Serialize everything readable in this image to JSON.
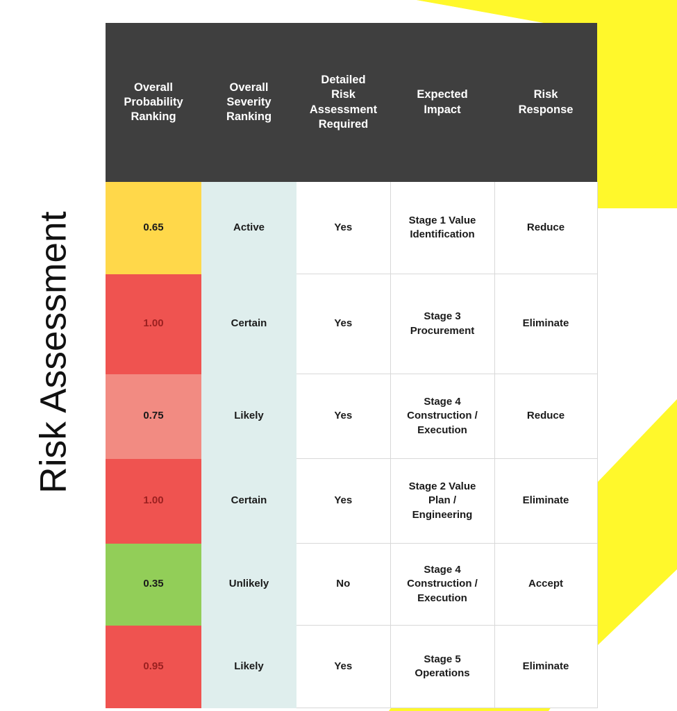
{
  "page": {
    "title": "Risk Assessment",
    "background_color": "#FFFFFF",
    "accent_color": "#FFF82B",
    "header_color": "#3F3F3F"
  },
  "decor": {
    "shapes": [
      {
        "name": "yellow-diagonal-band-top-right",
        "color": "#FFF82B"
      },
      {
        "name": "yellow-parallelogram-right",
        "color": "#FFF82B"
      },
      {
        "name": "yellow-parallelogram-bottom",
        "color": "#FFF82B"
      }
    ]
  },
  "table": {
    "columns": [
      "Overall Probability Ranking",
      "Overall Severity Ranking",
      "Detailed Risk Assessment Required",
      "Expected Impact",
      "Risk Response"
    ],
    "column_lines": [
      [
        "Overall",
        "Probability",
        "Ranking"
      ],
      [
        "Overall",
        "Severity",
        "Ranking"
      ],
      [
        "Detailed",
        "Risk",
        "Assessment",
        "Required"
      ],
      [
        "Expected",
        "Impact"
      ],
      [
        "Risk",
        "Response"
      ]
    ],
    "severity_column_color": "#DFEEED",
    "rows": [
      {
        "probability": "0.65",
        "probability_color": "#FFD84A",
        "probability_text_color": "#1a1a1a",
        "severity": "Active",
        "detailed_required": "Yes",
        "expected_impact": "Stage 1 Value Identification",
        "expected_impact_lines": [
          "Stage 1 Value",
          "Identification"
        ],
        "risk_response": "Reduce"
      },
      {
        "probability": "1.00",
        "probability_color": "#EF5350",
        "probability_text_color": "#9B2020",
        "severity": "Certain",
        "detailed_required": "Yes",
        "expected_impact": "Stage 3 Procurement",
        "expected_impact_lines": [
          "Stage 3",
          "Procurement"
        ],
        "risk_response": "Eliminate"
      },
      {
        "probability": "0.75",
        "probability_color": "#F28B82",
        "probability_text_color": "#1a1a1a",
        "severity": "Likely",
        "detailed_required": "Yes",
        "expected_impact": "Stage 4 Construction / Execution",
        "expected_impact_lines": [
          "Stage 4",
          "Construction /",
          "Execution"
        ],
        "risk_response": "Reduce"
      },
      {
        "probability": "1.00",
        "probability_color": "#EF5350",
        "probability_text_color": "#9B2020",
        "severity": "Certain",
        "detailed_required": "Yes",
        "expected_impact": "Stage 2 Value Plan / Engineering",
        "expected_impact_lines": [
          "Stage 2 Value",
          "Plan /",
          "Engineering"
        ],
        "risk_response": "Eliminate"
      },
      {
        "probability": "0.35",
        "probability_color": "#92CE58",
        "probability_text_color": "#1a1a1a",
        "severity": "Unlikely",
        "detailed_required": "No",
        "expected_impact": "Stage 4 Construction / Execution",
        "expected_impact_lines": [
          "Stage 4",
          "Construction /",
          "Execution"
        ],
        "risk_response": "Accept"
      },
      {
        "probability": "0.95",
        "probability_color": "#EF5350",
        "probability_text_color": "#9B2020",
        "severity": "Likely",
        "detailed_required": "Yes",
        "expected_impact": "Stage 5 Operations",
        "expected_impact_lines": [
          "Stage 5",
          "Operations"
        ],
        "risk_response": "Eliminate"
      }
    ]
  }
}
